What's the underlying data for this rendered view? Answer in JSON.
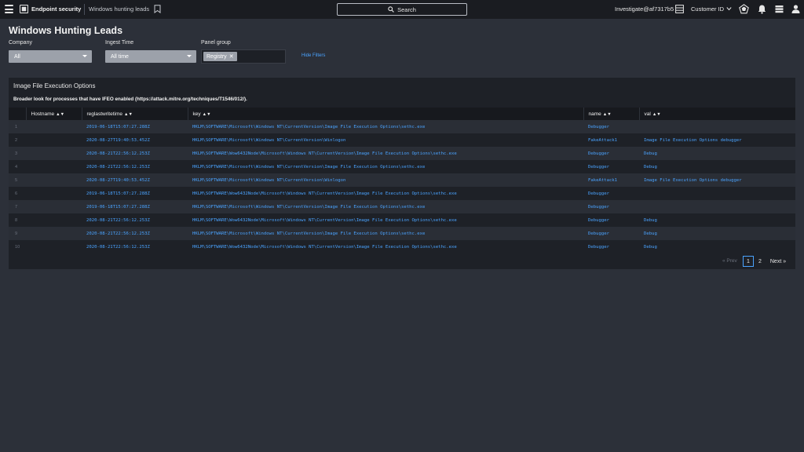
{
  "topbar": {
    "app_name": "Endpoint security",
    "breadcrumb": "Windows hunting leads",
    "search_label": "Search",
    "user": "Investigate@af7317b5",
    "customer_label": "Customer ID"
  },
  "page": {
    "title": "Windows Hunting Leads"
  },
  "filters": {
    "company": {
      "label": "Company",
      "value": "All"
    },
    "ingest_time": {
      "label": "Ingest Time",
      "value": "All time"
    },
    "panel_group": {
      "label": "Panel group",
      "chip": "Registry"
    },
    "hide_filters": "Hide Filters"
  },
  "panel": {
    "title": "Image File Execution Options",
    "description": "Broader look for processes that have IFEO enabled (https://attack.mitre.org/techniques/T1546/012/).",
    "columns": [
      "Hostname",
      "reglastwritetime",
      "key",
      "name",
      "val"
    ],
    "rows": [
      {
        "n": "1",
        "hostname": "",
        "time": "2019-06-18T15:07:27.288Z",
        "key": "HKLM\\SOFTWARE\\Microsoft\\Windows NT\\CurrentVersion\\Image File Execution Options\\sethc.exe",
        "name": "Debugger",
        "val": ""
      },
      {
        "n": "2",
        "hostname": "",
        "time": "2020-08-27T19:40:53.452Z",
        "key": "HKLM\\SOFTWARE\\Microsoft\\Windows NT\\CurrentVersion\\Winlogon",
        "name": "FakeAttack1",
        "val": "Image File Execution Options debugger"
      },
      {
        "n": "3",
        "hostname": "",
        "time": "2020-08-21T22:56:12.253Z",
        "key": "HKLM\\SOFTWARE\\Wow6432Node\\Microsoft\\Windows NT\\CurrentVersion\\Image File Execution Options\\sethc.exe",
        "name": "Debugger",
        "val": "Debug"
      },
      {
        "n": "4",
        "hostname": "",
        "time": "2020-08-21T22:56:12.253Z",
        "key": "HKLM\\SOFTWARE\\Microsoft\\Windows NT\\CurrentVersion\\Image File Execution Options\\sethc.exe",
        "name": "Debugger",
        "val": "Debug"
      },
      {
        "n": "5",
        "hostname": "",
        "time": "2020-08-27T19:40:53.452Z",
        "key": "HKLM\\SOFTWARE\\Microsoft\\Windows NT\\CurrentVersion\\Winlogon",
        "name": "FakeAttack1",
        "val": "Image File Execution Options debugger"
      },
      {
        "n": "6",
        "hostname": "",
        "time": "2019-06-18T15:07:27.288Z",
        "key": "HKLM\\SOFTWARE\\Wow6432Node\\Microsoft\\Windows NT\\CurrentVersion\\Image File Execution Options\\sethc.exe",
        "name": "Debugger",
        "val": ""
      },
      {
        "n": "7",
        "hostname": "",
        "time": "2019-06-18T15:07:27.288Z",
        "key": "HKLM\\SOFTWARE\\Microsoft\\Windows NT\\CurrentVersion\\Image File Execution Options\\sethc.exe",
        "name": "Debugger",
        "val": ""
      },
      {
        "n": "8",
        "hostname": "",
        "time": "2020-08-21T22:56:12.253Z",
        "key": "HKLM\\SOFTWARE\\Wow6432Node\\Microsoft\\Windows NT\\CurrentVersion\\Image File Execution Options\\sethc.exe",
        "name": "Debugger",
        "val": "Debug"
      },
      {
        "n": "9",
        "hostname": "",
        "time": "2020-08-21T22:56:12.253Z",
        "key": "HKLM\\SOFTWARE\\Microsoft\\Windows NT\\CurrentVersion\\Image File Execution Options\\sethc.exe",
        "name": "Debugger",
        "val": "Debug"
      },
      {
        "n": "10",
        "hostname": "",
        "time": "2020-08-21T22:56:12.253Z",
        "key": "HKLM\\SOFTWARE\\Wow6432Node\\Microsoft\\Windows NT\\CurrentVersion\\Image File Execution Options\\sethc.exe",
        "name": "Debugger",
        "val": "Debug"
      }
    ],
    "pagination": {
      "prev": "« Prev",
      "pages": [
        "1",
        "2"
      ],
      "current": "1",
      "next": "Next »"
    }
  },
  "icons": {
    "menu": "hamburger-icon",
    "app": "endpoint-logo-icon",
    "bookmark": "bookmark-icon",
    "search": "search-icon",
    "table": "table-icon",
    "chevron": "chevron-down-icon",
    "apps": "pentagon-apps-icon",
    "bell": "bell-icon",
    "switcher": "app-switcher-icon",
    "user": "user-icon"
  },
  "colors": {
    "link": "#4aa3ff",
    "background": "#2c3039",
    "topbar": "#1a1c21",
    "panel": "#1e2127"
  }
}
